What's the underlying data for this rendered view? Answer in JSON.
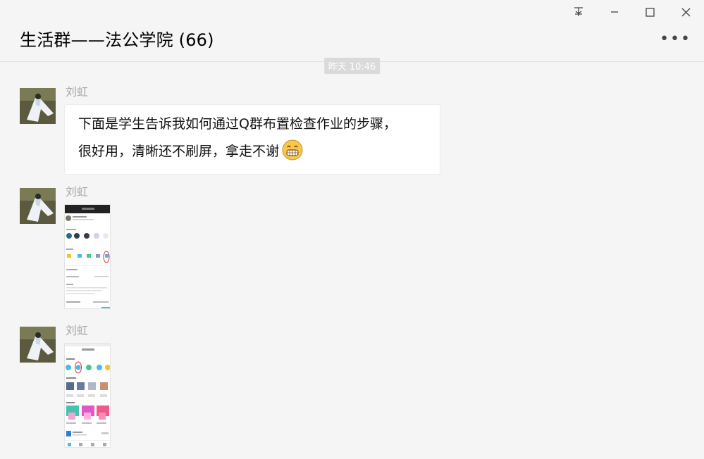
{
  "window": {
    "pin_icon": "pin-icon",
    "minimize_icon": "minimize-icon",
    "maximize_icon": "maximize-icon",
    "close_icon": "close-icon"
  },
  "header": {
    "title": "生活群——法公学院 (66)",
    "more_icon": "more-icon"
  },
  "timestamp": "昨天 10:46",
  "messages": [
    {
      "sender": "刘虹",
      "line1": "下面是学生告诉我如何通过Q群布置检查作业的步骤，",
      "line2": "很好用，清晰还不刷屏，拿走不谢",
      "emoji": "grin-emoji"
    },
    {
      "sender": "刘虹"
    },
    {
      "sender": "刘虹"
    }
  ]
}
